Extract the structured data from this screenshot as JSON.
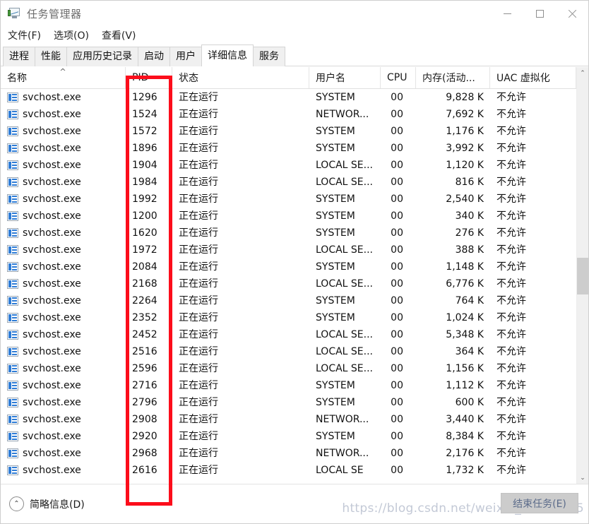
{
  "window": {
    "title": "任务管理器",
    "icon": "task-manager-icon",
    "controls": {
      "minimize": "—",
      "maximize": "▢",
      "close": "✕"
    }
  },
  "menu": {
    "items": [
      "文件(F)",
      "选项(O)",
      "查看(V)"
    ]
  },
  "tabs": [
    {
      "label": "进程",
      "active": false
    },
    {
      "label": "性能",
      "active": false
    },
    {
      "label": "应用历史记录",
      "active": false
    },
    {
      "label": "启动",
      "active": false
    },
    {
      "label": "用户",
      "active": false
    },
    {
      "label": "详细信息",
      "active": true
    },
    {
      "label": "服务",
      "active": false
    }
  ],
  "table": {
    "columns": [
      {
        "key": "name",
        "label": "名称",
        "sort": "^"
      },
      {
        "key": "pid",
        "label": "PID",
        "sort": ""
      },
      {
        "key": "state",
        "label": "状态",
        "sort": ""
      },
      {
        "key": "user",
        "label": "用户名",
        "sort": ""
      },
      {
        "key": "cpu",
        "label": "CPU",
        "sort": ""
      },
      {
        "key": "mem",
        "label": "内存(活动...",
        "sort": ""
      },
      {
        "key": "uac",
        "label": "UAC 虚拟化",
        "sort": ""
      }
    ],
    "rows": [
      {
        "name": "svchost.exe",
        "pid": "1296",
        "state": "正在运行",
        "user": "SYSTEM",
        "cpu": "00",
        "mem": "9,828 K",
        "uac": "不允许"
      },
      {
        "name": "svchost.exe",
        "pid": "1524",
        "state": "正在运行",
        "user": "NETWOR...",
        "cpu": "00",
        "mem": "7,692 K",
        "uac": "不允许"
      },
      {
        "name": "svchost.exe",
        "pid": "1572",
        "state": "正在运行",
        "user": "SYSTEM",
        "cpu": "00",
        "mem": "1,176 K",
        "uac": "不允许"
      },
      {
        "name": "svchost.exe",
        "pid": "1896",
        "state": "正在运行",
        "user": "SYSTEM",
        "cpu": "00",
        "mem": "3,992 K",
        "uac": "不允许"
      },
      {
        "name": "svchost.exe",
        "pid": "1904",
        "state": "正在运行",
        "user": "LOCAL SE...",
        "cpu": "00",
        "mem": "1,120 K",
        "uac": "不允许"
      },
      {
        "name": "svchost.exe",
        "pid": "1984",
        "state": "正在运行",
        "user": "LOCAL SE...",
        "cpu": "00",
        "mem": "816 K",
        "uac": "不允许"
      },
      {
        "name": "svchost.exe",
        "pid": "1992",
        "state": "正在运行",
        "user": "SYSTEM",
        "cpu": "00",
        "mem": "2,540 K",
        "uac": "不允许"
      },
      {
        "name": "svchost.exe",
        "pid": "1200",
        "state": "正在运行",
        "user": "SYSTEM",
        "cpu": "00",
        "mem": "340 K",
        "uac": "不允许"
      },
      {
        "name": "svchost.exe",
        "pid": "1620",
        "state": "正在运行",
        "user": "SYSTEM",
        "cpu": "00",
        "mem": "276 K",
        "uac": "不允许"
      },
      {
        "name": "svchost.exe",
        "pid": "1972",
        "state": "正在运行",
        "user": "LOCAL SE...",
        "cpu": "00",
        "mem": "388 K",
        "uac": "不允许"
      },
      {
        "name": "svchost.exe",
        "pid": "2084",
        "state": "正在运行",
        "user": "SYSTEM",
        "cpu": "00",
        "mem": "1,148 K",
        "uac": "不允许"
      },
      {
        "name": "svchost.exe",
        "pid": "2168",
        "state": "正在运行",
        "user": "LOCAL SE...",
        "cpu": "00",
        "mem": "6,776 K",
        "uac": "不允许"
      },
      {
        "name": "svchost.exe",
        "pid": "2264",
        "state": "正在运行",
        "user": "SYSTEM",
        "cpu": "00",
        "mem": "764 K",
        "uac": "不允许"
      },
      {
        "name": "svchost.exe",
        "pid": "2352",
        "state": "正在运行",
        "user": "SYSTEM",
        "cpu": "00",
        "mem": "1,024 K",
        "uac": "不允许"
      },
      {
        "name": "svchost.exe",
        "pid": "2452",
        "state": "正在运行",
        "user": "LOCAL SE...",
        "cpu": "00",
        "mem": "5,348 K",
        "uac": "不允许"
      },
      {
        "name": "svchost.exe",
        "pid": "2516",
        "state": "正在运行",
        "user": "LOCAL SE...",
        "cpu": "00",
        "mem": "364 K",
        "uac": "不允许"
      },
      {
        "name": "svchost.exe",
        "pid": "2596",
        "state": "正在运行",
        "user": "LOCAL SE...",
        "cpu": "00",
        "mem": "1,156 K",
        "uac": "不允许"
      },
      {
        "name": "svchost.exe",
        "pid": "2716",
        "state": "正在运行",
        "user": "SYSTEM",
        "cpu": "00",
        "mem": "1,112 K",
        "uac": "不允许"
      },
      {
        "name": "svchost.exe",
        "pid": "2796",
        "state": "正在运行",
        "user": "SYSTEM",
        "cpu": "00",
        "mem": "600 K",
        "uac": "不允许"
      },
      {
        "name": "svchost.exe",
        "pid": "2908",
        "state": "正在运行",
        "user": "NETWOR...",
        "cpu": "00",
        "mem": "3,440 K",
        "uac": "不允许"
      },
      {
        "name": "svchost.exe",
        "pid": "2920",
        "state": "正在运行",
        "user": "SYSTEM",
        "cpu": "00",
        "mem": "8,384 K",
        "uac": "不允许"
      },
      {
        "name": "svchost.exe",
        "pid": "2968",
        "state": "正在运行",
        "user": "NETWOR...",
        "cpu": "00",
        "mem": "2,176 K",
        "uac": "不允许"
      },
      {
        "name": "svchost.exe",
        "pid": "2616",
        "state": "正在运行",
        "user": "LOCAL SE",
        "cpu": "00",
        "mem": "1,732 K",
        "uac": "不允许"
      }
    ]
  },
  "scrollbar": {
    "up": "⌃",
    "down": "⌄"
  },
  "footer": {
    "brief_label": "简略信息(D)",
    "brief_arrow": "⌃",
    "end_task_label": "结束任务(E)",
    "watermark": "https://blog.csdn.net/weixin_44285445"
  },
  "annotation": {
    "color": "#fc0d1b",
    "target_column": "PID"
  }
}
